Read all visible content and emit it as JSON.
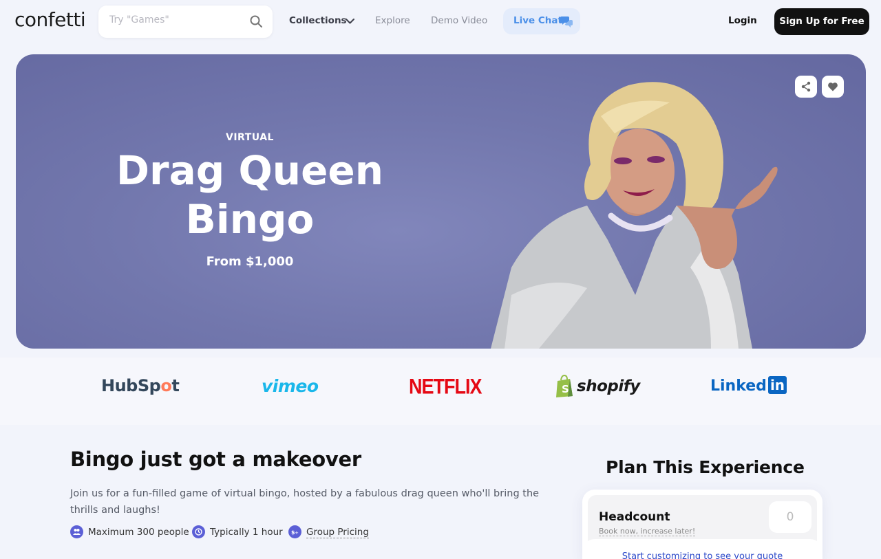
{
  "nav": {
    "logo": "confetti",
    "search_placeholder": "Try \"Games\"",
    "collections": "Collections",
    "explore": "Explore",
    "demo_video": "Demo Video",
    "live_chat": "Live Chat",
    "login": "Login",
    "signup": "Sign Up for Free"
  },
  "hero": {
    "eyebrow": "VIRTUAL",
    "title": "Drag Queen Bingo",
    "price": "From $1,000",
    "colors": {
      "background": "#7479b0"
    }
  },
  "logos": {
    "hubspot_a": "HubSp",
    "hubspot_o": "o",
    "hubspot_b": "t",
    "vimeo": "vimeo",
    "netflix": "NETFLIX",
    "shopify": "shopify",
    "linkedin_text": "Linked",
    "linkedin_in": "in"
  },
  "about": {
    "title": "Bingo just got a makeover",
    "description": "Join us for a fun-filled game of virtual bingo, hosted by a fabulous drag queen who'll bring the thrills and laughs!",
    "meta": [
      {
        "icon": "people-icon",
        "label": "Maximum 300 people"
      },
      {
        "icon": "clock-icon",
        "label": "Typically 1 hour"
      },
      {
        "icon": "pricing-icon",
        "label": "Group Pricing"
      }
    ]
  },
  "plan": {
    "title": "Plan This Experience",
    "headcount_label": "Headcount",
    "headcount_sub": "Book now, increase later!",
    "headcount_value": "0",
    "quote_prompt": "Start customizing to see your quote"
  }
}
